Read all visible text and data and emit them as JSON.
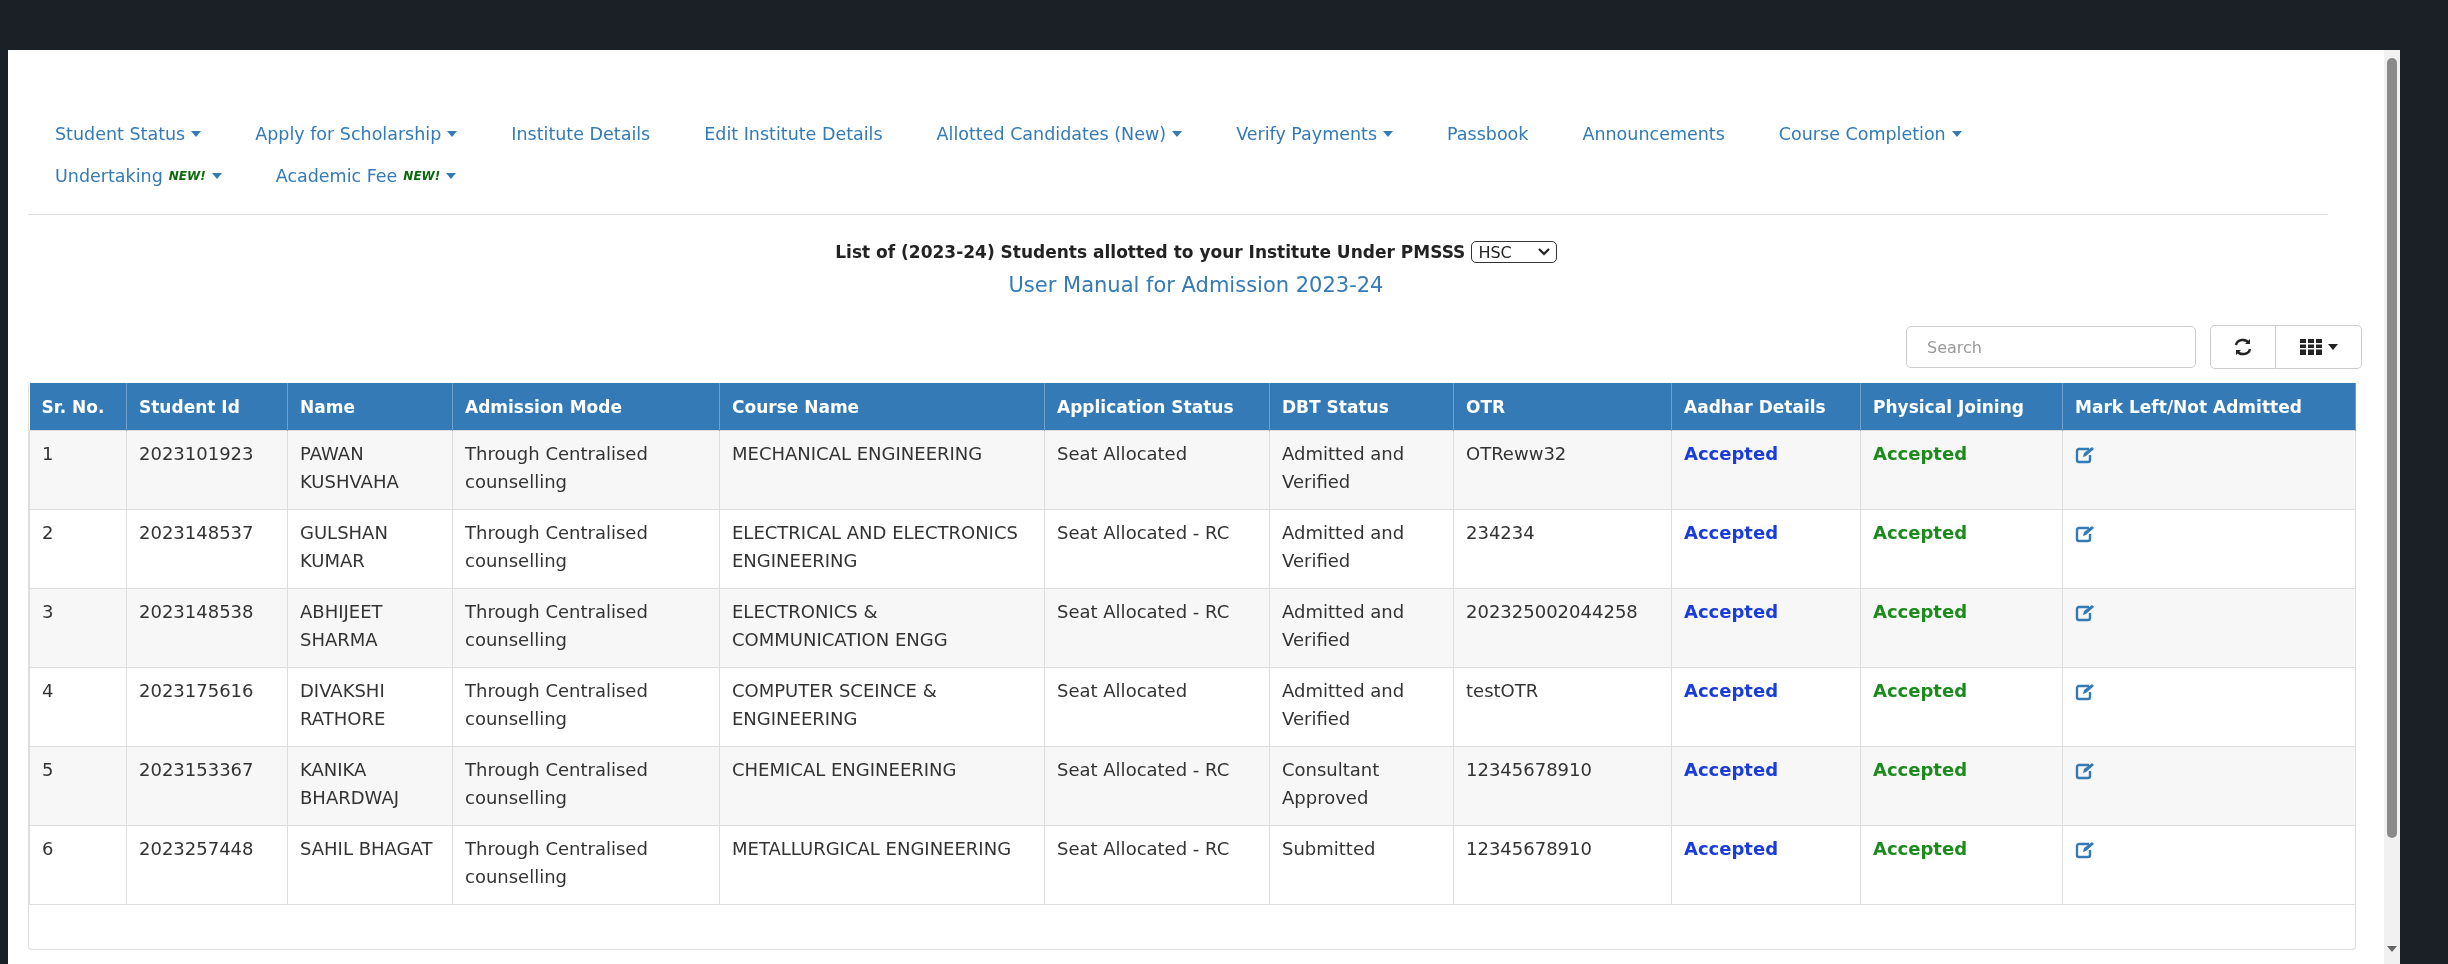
{
  "nav": {
    "items": [
      {
        "label": "Student Status",
        "caret": true
      },
      {
        "label": "Apply for Scholarship",
        "caret": true
      },
      {
        "label": "Institute Details",
        "caret": false
      },
      {
        "label": "Edit Institute Details",
        "caret": false
      },
      {
        "label": "Allotted Candidates (New)",
        "caret": true
      },
      {
        "label": "Verify Payments",
        "caret": true
      },
      {
        "label": "Passbook",
        "caret": false
      },
      {
        "label": "Announcements",
        "caret": false
      },
      {
        "label": "Course Completion",
        "caret": true
      },
      {
        "label": "Undertaking",
        "badge": "NEW!",
        "caret": true
      },
      {
        "label": "Academic Fee",
        "badge": "NEW!",
        "caret": true
      }
    ]
  },
  "heading": {
    "text": "List of (2023-24) Students allotted to your Institute Under PMSSS",
    "select_value": "HSC"
  },
  "manual_link": "User Manual for Admission 2023-24",
  "toolbar": {
    "search_placeholder": "Search"
  },
  "table": {
    "columns": [
      "Sr. No.",
      "Student Id",
      "Name",
      "Admission Mode",
      "Course Name",
      "Application Status",
      "DBT Status",
      "OTR",
      "Aadhar Details",
      "Physical Joining",
      "Mark Left/Not Admitted"
    ],
    "rows": [
      [
        "1",
        "2023101923",
        "PAWAN KUSHVAHA",
        "Through Centralised counselling",
        "MECHANICAL ENGINEERING",
        "Seat Allocated",
        "Admitted and Verified",
        "OTReww32",
        "Accepted",
        "Accepted"
      ],
      [
        "2",
        "2023148537",
        "GULSHAN KUMAR",
        "Through Centralised counselling",
        "ELECTRICAL AND ELECTRONICS ENGINEERING",
        "Seat Allocated - RC",
        "Admitted and Verified",
        "234234",
        "Accepted",
        "Accepted"
      ],
      [
        "3",
        "2023148538",
        "ABHIJEET SHARMA",
        "Through Centralised counselling",
        "ELECTRONICS & COMMUNICATION ENGG",
        "Seat Allocated - RC",
        "Admitted and Verified",
        "202325002044258",
        "Accepted",
        "Accepted"
      ],
      [
        "4",
        "2023175616",
        "DIVAKSHI RATHORE",
        "Through Centralised counselling",
        "COMPUTER SCEINCE & ENGINEERING",
        "Seat Allocated",
        "Admitted and Verified",
        "testOTR",
        "Accepted",
        "Accepted"
      ],
      [
        "5",
        "2023153367",
        "KANIKA BHARDWAJ",
        "Through Centralised counselling",
        "CHEMICAL ENGINEERING",
        "Seat Allocated - RC",
        "Consultant Approved",
        "12345678910",
        "Accepted",
        "Accepted"
      ],
      [
        "6",
        "2023257448",
        "SAHIL BHAGAT",
        "Through Centralised counselling",
        "METALLURGICAL ENGINEERING",
        "Seat Allocated - RC",
        "Submitted",
        "12345678910",
        "Accepted",
        "Accepted"
      ]
    ]
  }
}
